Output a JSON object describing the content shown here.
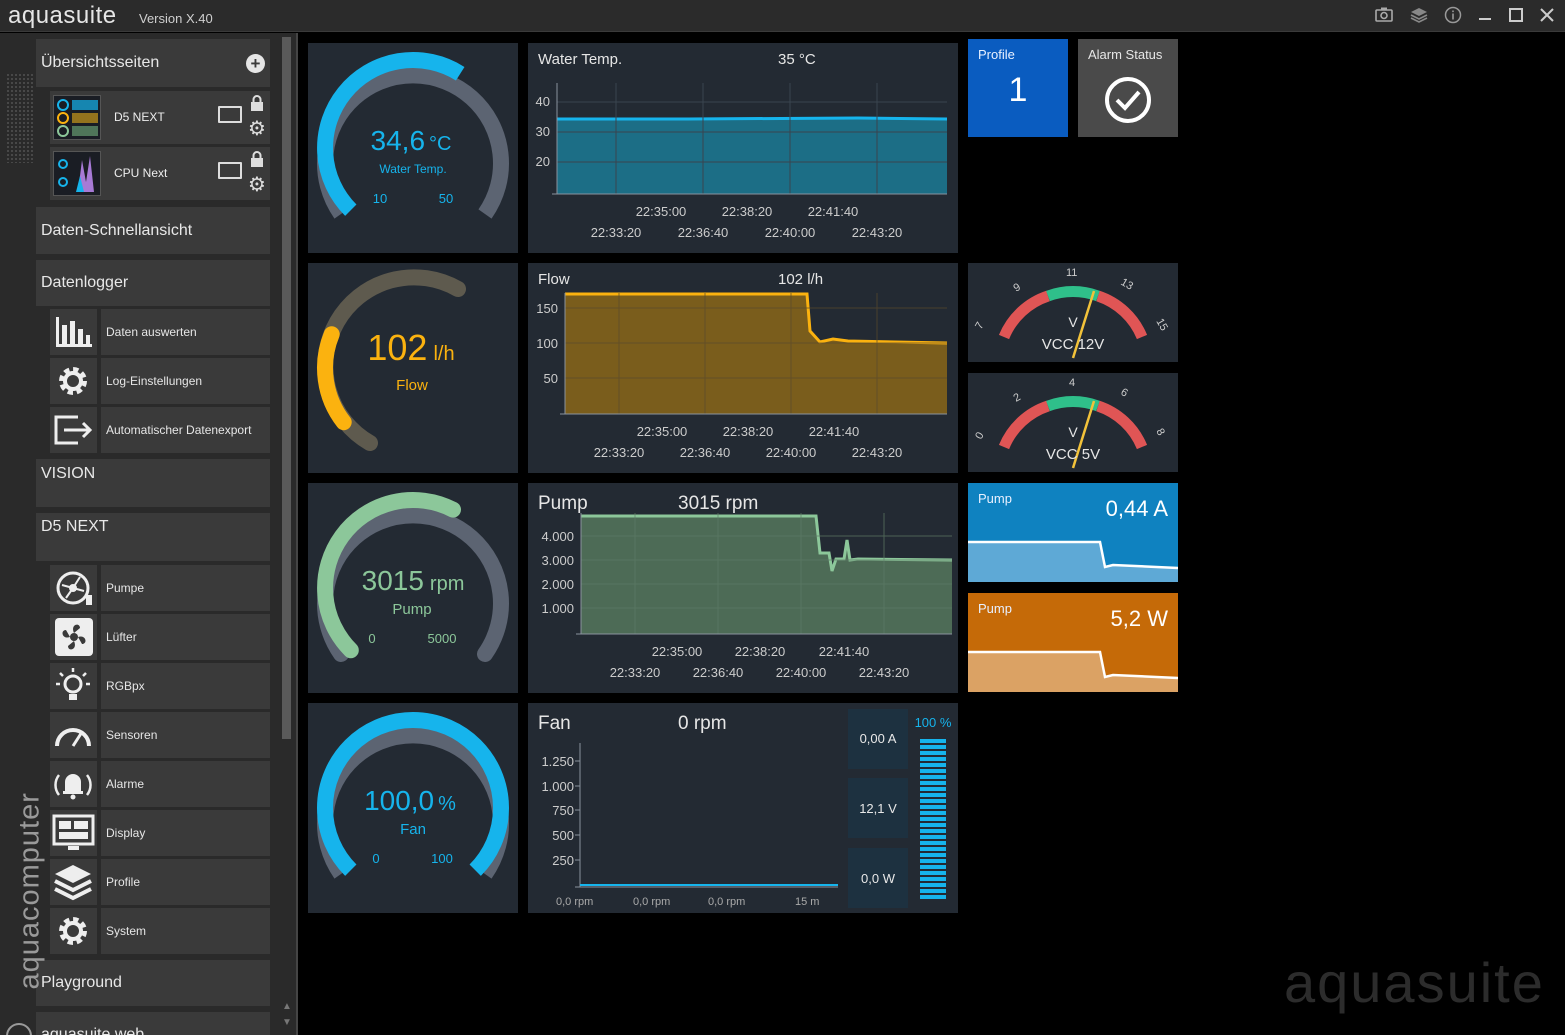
{
  "app": {
    "title": "aquasuite",
    "version": "Version X.40"
  },
  "titlebar": {
    "icons": [
      "camera-icon",
      "layers-icon",
      "info-icon",
      "minimize-icon",
      "maximize-icon",
      "close-icon"
    ]
  },
  "sidebar": {
    "overview": {
      "label": "Übersichtsseiten",
      "pages": [
        {
          "label": "D5 NEXT"
        },
        {
          "label": "CPU Next"
        }
      ]
    },
    "quickview": {
      "label": "Daten-Schnellansicht"
    },
    "datalogger": {
      "label": "Datenlogger",
      "items": [
        {
          "label": "Daten auswerten",
          "icon": "bar-chart-icon"
        },
        {
          "label": "Log-Einstellungen",
          "icon": "gear-icon"
        },
        {
          "label": "Automatischer Datenexport",
          "icon": "export-icon"
        }
      ]
    },
    "vision": {
      "label": "VISION"
    },
    "d5next": {
      "label": "D5 NEXT",
      "items": [
        {
          "label": "Pumpe",
          "icon": "pump-icon"
        },
        {
          "label": "Lüfter",
          "icon": "fan-icon"
        },
        {
          "label": "RGBpx",
          "icon": "bulb-icon"
        },
        {
          "label": "Sensoren",
          "icon": "gauge-icon"
        },
        {
          "label": "Alarme",
          "icon": "alarm-icon"
        },
        {
          "label": "Display",
          "icon": "display-icon"
        },
        {
          "label": "Profile",
          "icon": "layers-icon"
        },
        {
          "label": "System",
          "icon": "gear-icon"
        }
      ]
    },
    "playground": {
      "label": "Playground"
    },
    "web": {
      "label": "aquasuite web"
    },
    "brand": "aquacomputer"
  },
  "gauges": {
    "water": {
      "value": "34,6",
      "unit": "°C",
      "label": "Water Temp.",
      "min": "10",
      "max": "50",
      "fraction": 0.62,
      "color": "#16b4ec"
    },
    "flow": {
      "value": "102",
      "unit": "l/h",
      "label": "Flow",
      "fraction": 0.4,
      "color": "#fbb20f"
    },
    "pump": {
      "value": "3015",
      "unit": "rpm",
      "label": "Pump",
      "min": "0",
      "max": "5000",
      "fraction": 0.6,
      "color": "#8cc79a"
    },
    "fan": {
      "value": "100,0",
      "unit": "%",
      "label": "Fan",
      "min": "0",
      "max": "100",
      "fraction": 1.0,
      "color": "#16b4ec"
    }
  },
  "charts": {
    "water": {
      "title": "Water Temp.",
      "value": "35 °C",
      "yticks": [
        "40",
        "30",
        "20"
      ],
      "xticks_top": [
        "22:35:00",
        "22:38:20",
        "22:41:40"
      ],
      "xticks_bottom": [
        "22:33:20",
        "22:36:40",
        "22:40:00",
        "22:43:20"
      ]
    },
    "flow": {
      "title": "Flow",
      "value": "102 l/h",
      "yticks": [
        "150",
        "100",
        "50"
      ],
      "xticks_top": [
        "22:35:00",
        "22:38:20",
        "22:41:40"
      ],
      "xticks_bottom": [
        "22:33:20",
        "22:36:40",
        "22:40:00",
        "22:43:20"
      ]
    },
    "pump": {
      "title": "Pump",
      "value": "3015 rpm",
      "yticks": [
        "4.000",
        "3.000",
        "2.000",
        "1.000"
      ],
      "xticks_top": [
        "22:35:00",
        "22:38:20",
        "22:41:40"
      ],
      "xticks_bottom": [
        "22:33:20",
        "22:36:40",
        "22:40:00",
        "22:43:20"
      ]
    },
    "fan": {
      "title": "Fan",
      "value": "0 rpm",
      "yticks": [
        "1.250",
        "1.000",
        "750",
        "500",
        "250"
      ],
      "footer": [
        "0,0 rpm",
        "0,0 rpm",
        "0,0 rpm",
        "15 m"
      ],
      "boxes": [
        "0,00 A",
        "12,1 V",
        "0,0 W"
      ],
      "bar_label": "100 %"
    }
  },
  "tiles": {
    "profile": {
      "label": "Profile",
      "value": "1"
    },
    "alarm": {
      "label": "Alarm Status"
    },
    "vcc12": {
      "unit": "V",
      "label": "VCC 12V",
      "ticks": [
        "7",
        "9",
        "11",
        "13",
        "15"
      ]
    },
    "vcc5": {
      "unit": "V",
      "label": "VCC 5V",
      "ticks": [
        "0",
        "2",
        "4",
        "6",
        "8"
      ]
    },
    "pump_current": {
      "label": "Pump",
      "value": "0,44 A"
    },
    "pump_power": {
      "label": "Pump",
      "value": "5,2 W"
    }
  },
  "watermark": "aquasuite"
}
